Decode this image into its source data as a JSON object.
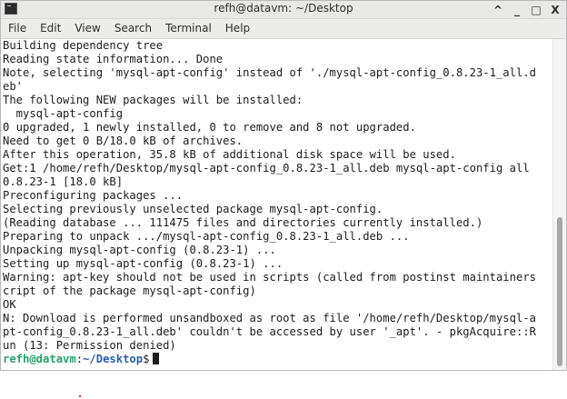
{
  "window": {
    "title": "refh@datavm: ~/Desktop",
    "controls": {
      "collapse": "^",
      "minimize": "_",
      "maximize": "□",
      "close": "X"
    }
  },
  "menubar": {
    "items": [
      "File",
      "Edit",
      "View",
      "Search",
      "Terminal",
      "Help"
    ]
  },
  "terminal": {
    "lines": [
      "Building dependency tree",
      "Reading state information... Done",
      "Note, selecting 'mysql-apt-config' instead of './mysql-apt-config_0.8.23-1_all.d",
      "eb'",
      "The following NEW packages will be installed:",
      "  mysql-apt-config",
      "0 upgraded, 1 newly installed, 0 to remove and 8 not upgraded.",
      "Need to get 0 B/18.0 kB of archives.",
      "After this operation, 35.8 kB of additional disk space will be used.",
      "Get:1 /home/refh/Desktop/mysql-apt-config_0.8.23-1_all.deb mysql-apt-config all",
      "0.8.23-1 [18.0 kB]",
      "Preconfiguring packages ...",
      "Selecting previously unselected package mysql-apt-config.",
      "(Reading database ... 111475 files and directories currently installed.)",
      "Preparing to unpack .../mysql-apt-config_0.8.23-1_all.deb ...",
      "Unpacking mysql-apt-config (0.8.23-1) ...",
      "Setting up mysql-apt-config (0.8.23-1) ...",
      "Warning: apt-key should not be used in scripts (called from postinst maintainers",
      "cript of the package mysql-apt-config)",
      "OK",
      "N: Download is performed unsandboxed as root as file '/home/refh/Desktop/mysql-a",
      "pt-config_0.8.23-1_all.deb' couldn't be accessed by user '_apt'. - pkgAcquire::R",
      "un (13: Permission denied)"
    ],
    "prompt": {
      "user_host": "refh@datavm",
      "separator": ":",
      "path": "~/Desktop",
      "symbol": "$"
    }
  },
  "colors": {
    "prompt_user": "#26a269",
    "prompt_path": "#2a5db0",
    "text": "#1c1c1c",
    "background": "#ffffff"
  }
}
